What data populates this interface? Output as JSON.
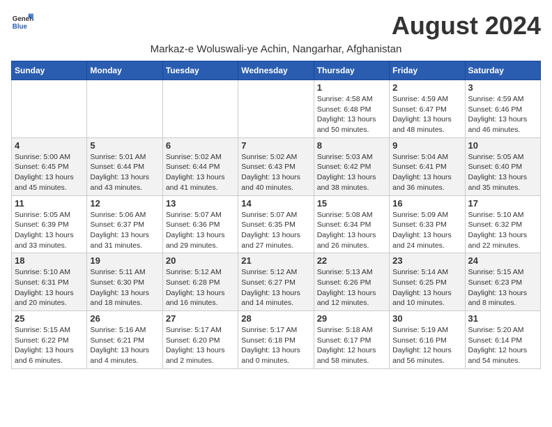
{
  "logo": {
    "line1": "General",
    "line2": "Blue"
  },
  "title": "August 2024",
  "subtitle": "Markaz-e Woluswali-ye Achin, Nangarhar, Afghanistan",
  "weekdays": [
    "Sunday",
    "Monday",
    "Tuesday",
    "Wednesday",
    "Thursday",
    "Friday",
    "Saturday"
  ],
  "weeks": [
    [
      {
        "day": "",
        "info": ""
      },
      {
        "day": "",
        "info": ""
      },
      {
        "day": "",
        "info": ""
      },
      {
        "day": "",
        "info": ""
      },
      {
        "day": "1",
        "info": "Sunrise: 4:58 AM\nSunset: 6:48 PM\nDaylight: 13 hours\nand 50 minutes."
      },
      {
        "day": "2",
        "info": "Sunrise: 4:59 AM\nSunset: 6:47 PM\nDaylight: 13 hours\nand 48 minutes."
      },
      {
        "day": "3",
        "info": "Sunrise: 4:59 AM\nSunset: 6:46 PM\nDaylight: 13 hours\nand 46 minutes."
      }
    ],
    [
      {
        "day": "4",
        "info": "Sunrise: 5:00 AM\nSunset: 6:45 PM\nDaylight: 13 hours\nand 45 minutes."
      },
      {
        "day": "5",
        "info": "Sunrise: 5:01 AM\nSunset: 6:44 PM\nDaylight: 13 hours\nand 43 minutes."
      },
      {
        "day": "6",
        "info": "Sunrise: 5:02 AM\nSunset: 6:44 PM\nDaylight: 13 hours\nand 41 minutes."
      },
      {
        "day": "7",
        "info": "Sunrise: 5:02 AM\nSunset: 6:43 PM\nDaylight: 13 hours\nand 40 minutes."
      },
      {
        "day": "8",
        "info": "Sunrise: 5:03 AM\nSunset: 6:42 PM\nDaylight: 13 hours\nand 38 minutes."
      },
      {
        "day": "9",
        "info": "Sunrise: 5:04 AM\nSunset: 6:41 PM\nDaylight: 13 hours\nand 36 minutes."
      },
      {
        "day": "10",
        "info": "Sunrise: 5:05 AM\nSunset: 6:40 PM\nDaylight: 13 hours\nand 35 minutes."
      }
    ],
    [
      {
        "day": "11",
        "info": "Sunrise: 5:05 AM\nSunset: 6:39 PM\nDaylight: 13 hours\nand 33 minutes."
      },
      {
        "day": "12",
        "info": "Sunrise: 5:06 AM\nSunset: 6:37 PM\nDaylight: 13 hours\nand 31 minutes."
      },
      {
        "day": "13",
        "info": "Sunrise: 5:07 AM\nSunset: 6:36 PM\nDaylight: 13 hours\nand 29 minutes."
      },
      {
        "day": "14",
        "info": "Sunrise: 5:07 AM\nSunset: 6:35 PM\nDaylight: 13 hours\nand 27 minutes."
      },
      {
        "day": "15",
        "info": "Sunrise: 5:08 AM\nSunset: 6:34 PM\nDaylight: 13 hours\nand 26 minutes."
      },
      {
        "day": "16",
        "info": "Sunrise: 5:09 AM\nSunset: 6:33 PM\nDaylight: 13 hours\nand 24 minutes."
      },
      {
        "day": "17",
        "info": "Sunrise: 5:10 AM\nSunset: 6:32 PM\nDaylight: 13 hours\nand 22 minutes."
      }
    ],
    [
      {
        "day": "18",
        "info": "Sunrise: 5:10 AM\nSunset: 6:31 PM\nDaylight: 13 hours\nand 20 minutes."
      },
      {
        "day": "19",
        "info": "Sunrise: 5:11 AM\nSunset: 6:30 PM\nDaylight: 13 hours\nand 18 minutes."
      },
      {
        "day": "20",
        "info": "Sunrise: 5:12 AM\nSunset: 6:28 PM\nDaylight: 13 hours\nand 16 minutes."
      },
      {
        "day": "21",
        "info": "Sunrise: 5:12 AM\nSunset: 6:27 PM\nDaylight: 13 hours\nand 14 minutes."
      },
      {
        "day": "22",
        "info": "Sunrise: 5:13 AM\nSunset: 6:26 PM\nDaylight: 13 hours\nand 12 minutes."
      },
      {
        "day": "23",
        "info": "Sunrise: 5:14 AM\nSunset: 6:25 PM\nDaylight: 13 hours\nand 10 minutes."
      },
      {
        "day": "24",
        "info": "Sunrise: 5:15 AM\nSunset: 6:23 PM\nDaylight: 13 hours\nand 8 minutes."
      }
    ],
    [
      {
        "day": "25",
        "info": "Sunrise: 5:15 AM\nSunset: 6:22 PM\nDaylight: 13 hours\nand 6 minutes."
      },
      {
        "day": "26",
        "info": "Sunrise: 5:16 AM\nSunset: 6:21 PM\nDaylight: 13 hours\nand 4 minutes."
      },
      {
        "day": "27",
        "info": "Sunrise: 5:17 AM\nSunset: 6:20 PM\nDaylight: 13 hours\nand 2 minutes."
      },
      {
        "day": "28",
        "info": "Sunrise: 5:17 AM\nSunset: 6:18 PM\nDaylight: 13 hours\nand 0 minutes."
      },
      {
        "day": "29",
        "info": "Sunrise: 5:18 AM\nSunset: 6:17 PM\nDaylight: 12 hours\nand 58 minutes."
      },
      {
        "day": "30",
        "info": "Sunrise: 5:19 AM\nSunset: 6:16 PM\nDaylight: 12 hours\nand 56 minutes."
      },
      {
        "day": "31",
        "info": "Sunrise: 5:20 AM\nSunset: 6:14 PM\nDaylight: 12 hours\nand 54 minutes."
      }
    ]
  ]
}
